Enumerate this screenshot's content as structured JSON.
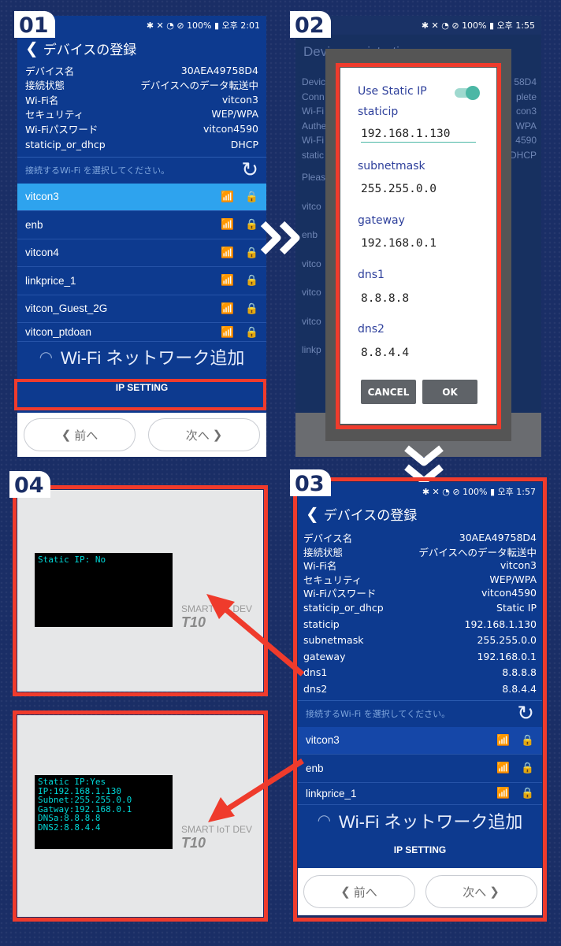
{
  "panel01": {
    "badge": "01",
    "status": "✱ ✕ ◔ ⊘ 100% ▮ 오후 2:01",
    "title": "デバイスの登録",
    "info": [
      [
        "デバイス名",
        "30AEA49758D4"
      ],
      [
        "接続状態",
        "デバイスへのデータ転送中"
      ],
      [
        "Wi-Fi名",
        "vitcon3"
      ],
      [
        "セキュリティ",
        "WEP/WPA"
      ],
      [
        "Wi-Fiパスワード",
        "vitcon4590"
      ],
      [
        "staticip_or_dhcp",
        "DHCP"
      ]
    ],
    "prompt": "接続するWi-Fi を選択してください。",
    "networks": [
      "vitcon3",
      "enb",
      "vitcon4",
      "linkprice_1",
      "vitcon_Guest_2G",
      "vitcon_ptdoan"
    ],
    "add_network": "Wi-Fi ネットワーク追加",
    "ip_setting": "IP SETTING",
    "prev": "前へ",
    "next": "次へ"
  },
  "panel02": {
    "badge": "02",
    "status": "✱ ✕ ◔ ⊘ 100% ▮ 오후 1:55",
    "bg_title": "Device registration",
    "bg_labels": [
      "Devic",
      "Conn",
      "Wi-Fi",
      "Authe",
      "Wi-Fi",
      "static",
      "Pleas",
      "vitco",
      "enb",
      "vitco",
      "vitco",
      "vitco",
      "linkp"
    ],
    "bg_values": [
      "58D4",
      "plete",
      "con3",
      "WPA",
      "4590",
      "DHCP"
    ],
    "dialog": {
      "use_static": "Use Static IP",
      "staticip_label": "staticip",
      "staticip": "192.168.1.130",
      "subnet_label": "subnetmask",
      "subnet": "255.255.0.0",
      "gateway_label": "gateway",
      "gateway": "192.168.0.1",
      "dns1_label": "dns1",
      "dns1": "8.8.8.8",
      "dns2_label": "dns2",
      "dns2": "8.8.4.4",
      "cancel": "CANCEL",
      "ok": "OK"
    }
  },
  "panel03": {
    "badge": "03",
    "status": "✱ ✕ ◔ ⊘ 100% ▮ 오후 1:57",
    "title": "デバイスの登録",
    "info": [
      [
        "デバイス名",
        "30AEA49758D4"
      ],
      [
        "接続状態",
        "デバイスへのデータ転送中"
      ],
      [
        "Wi-Fi名",
        "vitcon3"
      ],
      [
        "セキュリティ",
        "WEP/WPA"
      ],
      [
        "Wi-Fiパスワード",
        "vitcon4590"
      ],
      [
        "staticip_or_dhcp",
        "Static IP"
      ],
      [
        "staticip",
        "192.168.1.130"
      ],
      [
        "subnetmask",
        "255.255.0.0"
      ],
      [
        "gateway",
        "192.168.0.1"
      ],
      [
        "dns1",
        "8.8.8.8"
      ],
      [
        "dns2",
        "8.8.4.4"
      ]
    ],
    "prompt": "接続するWi-Fi を選択してください。",
    "networks": [
      "vitcon3",
      "enb",
      "linkprice_1"
    ],
    "add_network": "Wi-Fi ネットワーク追加",
    "ip_setting": "IP SETTING",
    "prev": "前へ",
    "next": "次へ"
  },
  "panel04": {
    "badge": "04",
    "lcd_top": [
      "Static IP: No"
    ],
    "lcd_bottom": [
      "Static IP:Yes",
      "IP:192.168.1.130",
      "Subnet:255.255.0.0",
      "Gatway:192.168.0.1",
      "DNSa:8.8.8.8",
      "DNS2:8.8.4.4"
    ],
    "device_label": "SMART IoT DEV",
    "device_model": "T10"
  },
  "colors": {
    "accent_red": "#ef3b2c",
    "app_blue": "#0d3a8f",
    "selected_row": "#2ea3ee",
    "page_bg": "#1a2e66"
  }
}
